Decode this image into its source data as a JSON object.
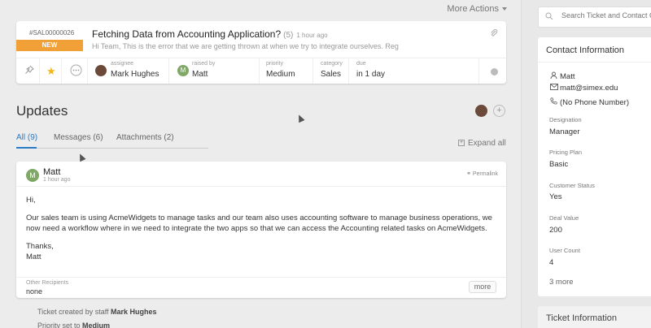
{
  "toolbar": {
    "more_actions": "More Actions"
  },
  "ticket": {
    "id": "#SAL00000026",
    "status": "NEW",
    "title": "Fetching Data from Accounting Application?",
    "count": "(5)",
    "time": "1 hour ago",
    "preview": "Hi Team, This is the error that we are getting thrown at when we try to integrate ourselves. Reg",
    "assignee_label": "assignee",
    "assignee": "Mark Hughes",
    "raised_by_label": "raised by",
    "raised_by": "Matt",
    "raised_by_initial": "M",
    "priority_label": "priority",
    "priority": "Medium",
    "category_label": "category",
    "category": "Sales",
    "due_label": "due",
    "due": "in 1 day"
  },
  "updates": {
    "title": "Updates",
    "add": "+",
    "tabs": [
      {
        "label": "All (9)"
      },
      {
        "label": "Messages (6)"
      },
      {
        "label": "Attachments (2)"
      }
    ],
    "expand_all": "Expand all"
  },
  "message": {
    "avatar_initial": "M",
    "author": "Matt",
    "time": "1 hour ago",
    "permalink": "Permalink",
    "greeting": "Hi,",
    "body": "Our sales team is using AcmeWidgets to manage tasks and our team also uses accounting software to manage business operations, we now need a workflow where in we need to integrate the two apps so that we can access the Accounting related tasks on AcmeWidgets.",
    "closing": "Thanks,",
    "signature": "Matt",
    "recipients_label": "Other Recipients",
    "recipients": "none",
    "more": "more"
  },
  "activity": [
    {
      "prefix": "Ticket created by staff ",
      "value": "Mark Hughes"
    },
    {
      "prefix": "Priority set to ",
      "value": "Medium"
    }
  ],
  "sidebar": {
    "search_placeholder": "Search Ticket and Contact Created",
    "contact_title": "Contact Information",
    "name": "Matt",
    "email": "matt@simex.edu",
    "phone": "(No Phone Number)",
    "fields": [
      {
        "label": "Designation",
        "value": "Manager"
      },
      {
        "label": "Pricing Plan",
        "value": "Basic"
      },
      {
        "label": "Customer Status",
        "value": "Yes"
      },
      {
        "label": "Deal Value",
        "value": "200"
      },
      {
        "label": "User Count",
        "value": "4"
      }
    ],
    "more": "3 more",
    "ticket_info_title": "Ticket Information"
  },
  "colors": {
    "new_badge": "#f0a037",
    "active_tab": "#2b7bc4",
    "avatar_green": "#7fa867"
  }
}
